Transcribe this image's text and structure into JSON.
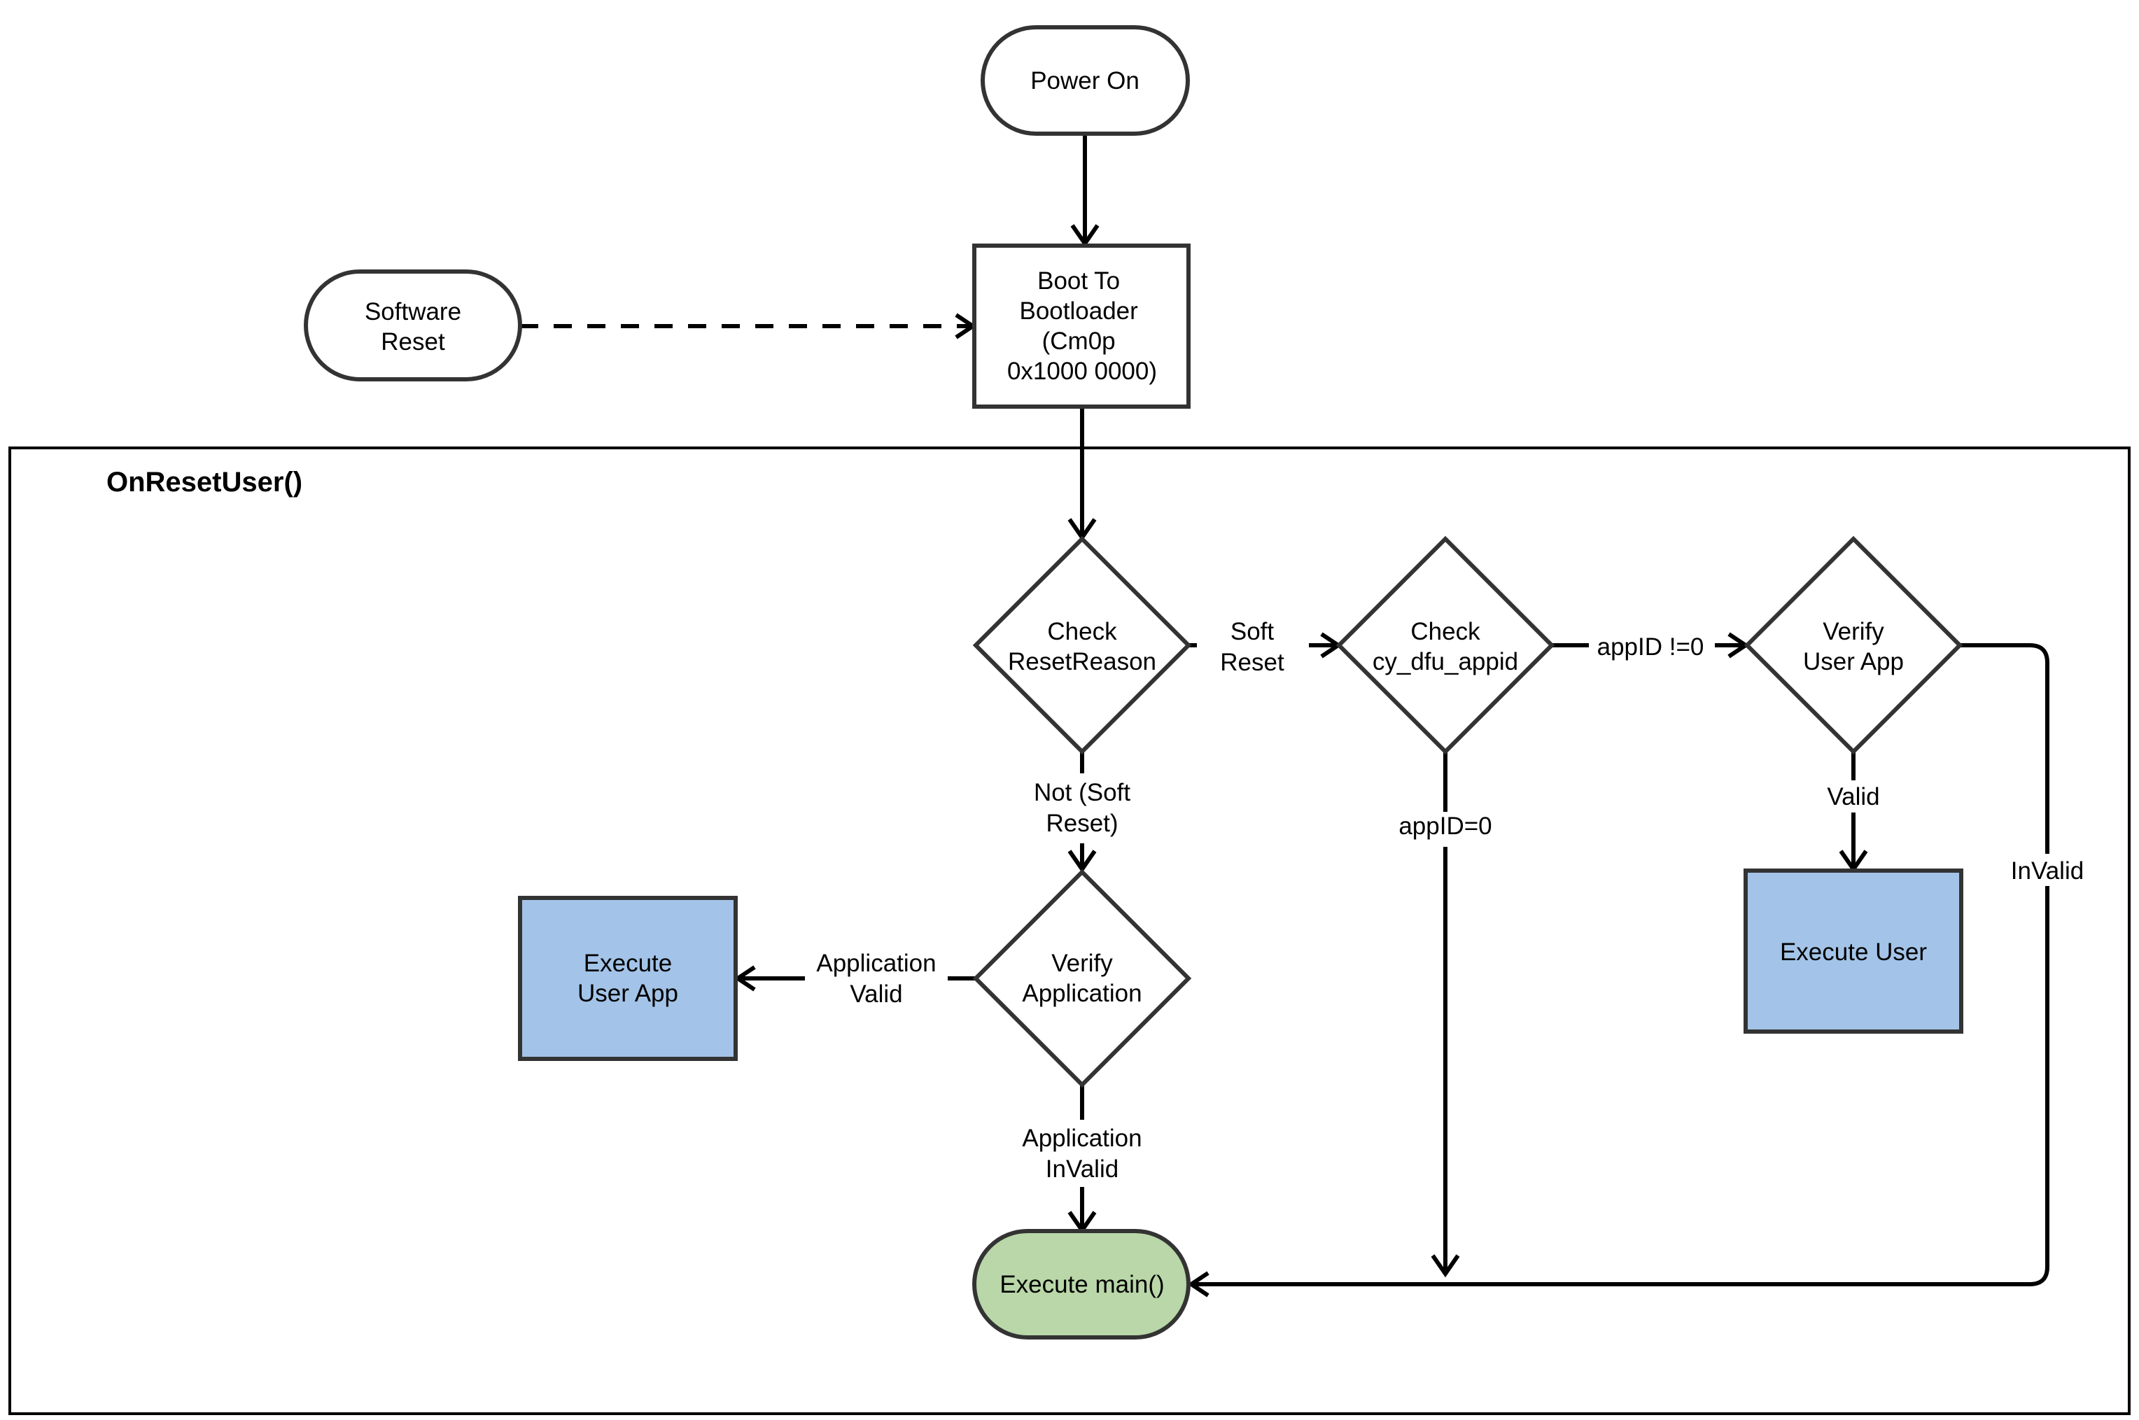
{
  "colors": {
    "stroke": "#333333",
    "edge": "#000000",
    "user_app_fill": "#a3c4e8",
    "main_fill": "#b9d7a8",
    "default_fill": "#ffffff"
  },
  "frame": {
    "title": "OnResetUser()"
  },
  "nodes": {
    "power_on": {
      "type": "terminator",
      "lines": [
        "Power On"
      ]
    },
    "software_reset": {
      "type": "terminator",
      "lines": [
        "Software",
        "Reset"
      ]
    },
    "boot": {
      "type": "process",
      "lines": [
        "Boot To",
        "Bootloader",
        "(Cm0p",
        "0x1000 0000)"
      ]
    },
    "check_reset": {
      "type": "decision",
      "lines": [
        "Check",
        "ResetReason"
      ]
    },
    "check_appid": {
      "type": "decision",
      "lines": [
        "Check",
        "cy_dfu_appid"
      ]
    },
    "verify_user_app": {
      "type": "decision",
      "lines": [
        "Verify",
        "User App"
      ]
    },
    "verify_app": {
      "type": "decision",
      "lines": [
        "Verify",
        "Application"
      ]
    },
    "exec_user_app": {
      "type": "process",
      "lines": [
        "Execute",
        "User App"
      ]
    },
    "exec_user": {
      "type": "process",
      "lines": [
        "Execute User"
      ]
    },
    "exec_main": {
      "type": "terminator",
      "lines": [
        "Execute main()"
      ]
    }
  },
  "edges": {
    "soft_reset": [
      "Soft",
      "Reset"
    ],
    "not_soft_reset": [
      "Not (Soft",
      "Reset)"
    ],
    "appid_nonzero": [
      "appID !=0"
    ],
    "appid_zero": [
      "appID=0"
    ],
    "valid": [
      "Valid"
    ],
    "invalid": [
      "InValid"
    ],
    "app_valid": [
      "Application",
      "Valid"
    ],
    "app_invalid": [
      "Application",
      "InValid"
    ]
  }
}
